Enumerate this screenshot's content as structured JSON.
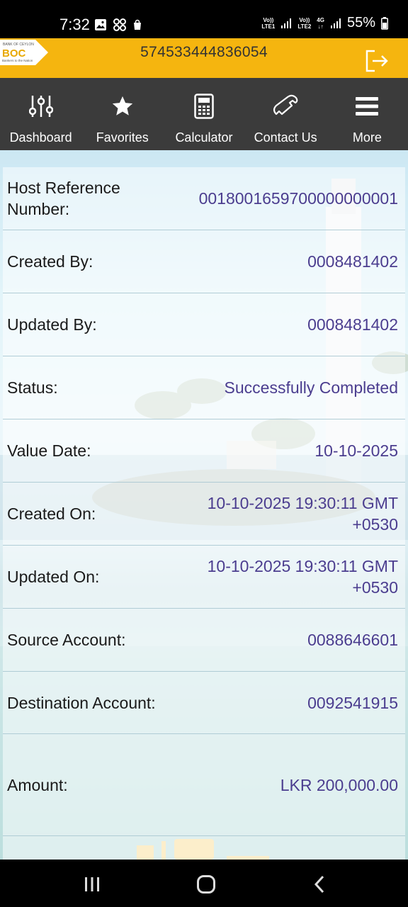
{
  "status_bar": {
    "time": "7:32",
    "sim1_label_top": "Vo))",
    "sim1_label_bottom": "LTE1",
    "sim2_label_top": "Vo))",
    "sim2_label_bottom": "LTE2",
    "network": "4G",
    "battery": "55%"
  },
  "header": {
    "account_number": "574533444836054",
    "logo_text": "BOC",
    "logo_top_text": "BANK OF CEYLON",
    "logo_tagline": "Bankers to the Nation",
    "brand_color": "#f5b50f"
  },
  "nav": {
    "items": [
      {
        "label": "Dashboard",
        "icon": "sliders-icon"
      },
      {
        "label": "Favorites",
        "icon": "star-icon"
      },
      {
        "label": "Calculator",
        "icon": "calculator-icon"
      },
      {
        "label": "Contact Us",
        "icon": "phone-icon"
      },
      {
        "label": "More",
        "icon": "menu-icon"
      }
    ]
  },
  "details": {
    "rows": [
      {
        "label": "Host Reference Number:",
        "value": "0018001659700000000001"
      },
      {
        "label": "Created By:",
        "value": "0008481402"
      },
      {
        "label": "Updated By:",
        "value": "0008481402"
      },
      {
        "label": "Status:",
        "value": "Successfully Completed"
      },
      {
        "label": "Value Date:",
        "value": "10-10-2025"
      },
      {
        "label": "Created On:",
        "value": "10-10-2025 19:30:11 GMT +0530"
      },
      {
        "label": "Updated On:",
        "value": "10-10-2025 19:30:11 GMT +0530"
      },
      {
        "label": "Source Account:",
        "value": "0088646601"
      },
      {
        "label": "Destination Account:",
        "value": "0092541915"
      },
      {
        "label": "Amount:",
        "value": "LKR 200,000.00"
      }
    ]
  },
  "colors": {
    "value_text": "#4b3d8f",
    "nav_bg": "#3b3b3b"
  }
}
